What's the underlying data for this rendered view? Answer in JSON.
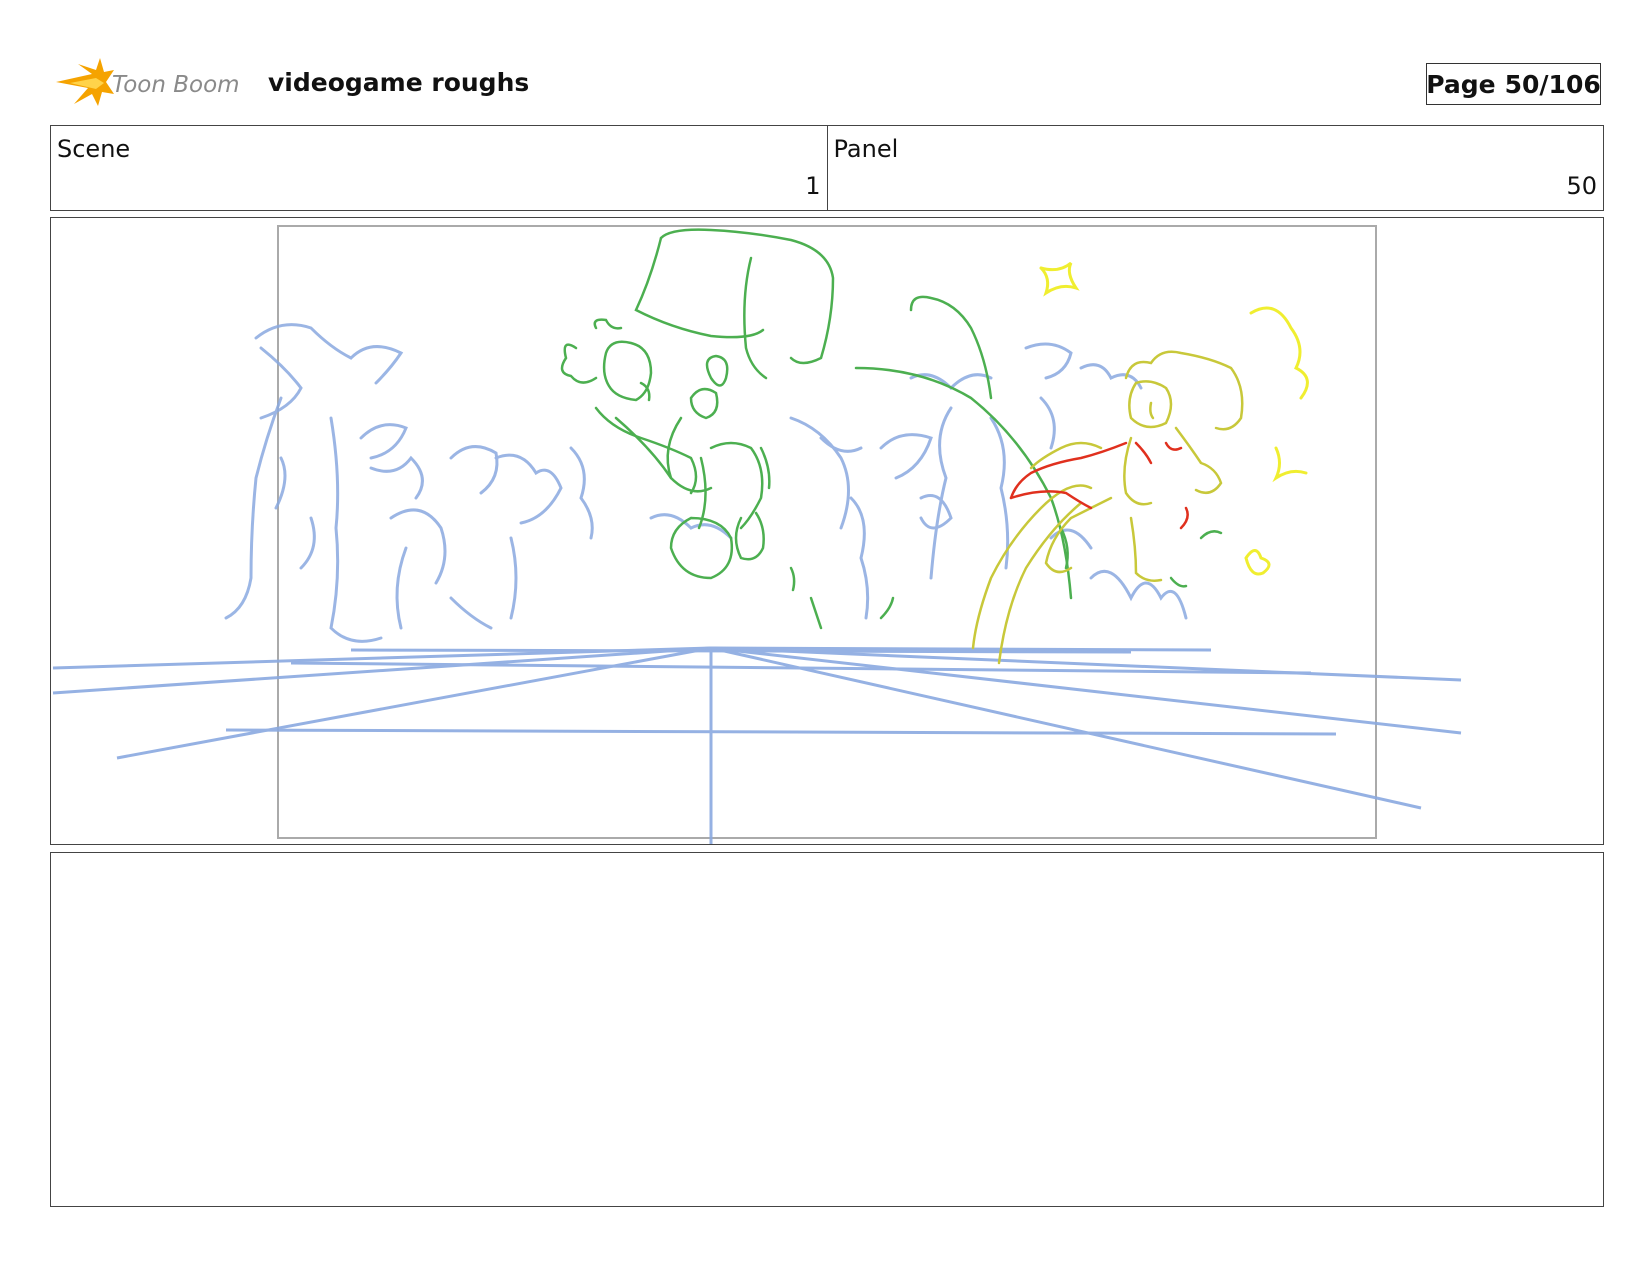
{
  "header": {
    "logo_text": "Toon Boom",
    "logo_icon": "starburst-icon",
    "title": "videogame roughs",
    "page_label": "Page",
    "page_number": "50/106"
  },
  "info": {
    "scene_label": "Scene",
    "scene_value": "1",
    "panel_label": "Panel",
    "panel_value": "50"
  },
  "colors": {
    "blue_sketch": "#8aa9e0",
    "green_sketch": "#4caf50",
    "yellow_sketch": "#c8c83a",
    "bright_yellow": "#f0ee30",
    "red_sketch": "#e0301e",
    "logo_orange": "#f5a300",
    "logo_text": "#8a8a8a"
  },
  "notes": {
    "text": ""
  }
}
